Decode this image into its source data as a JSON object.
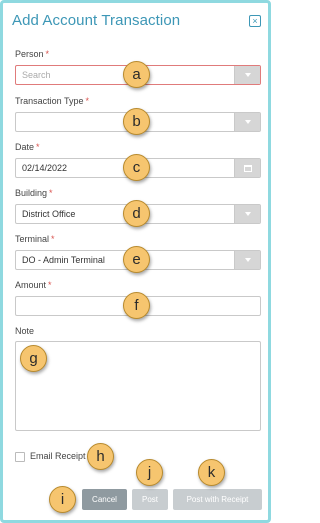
{
  "modal": {
    "title": "Add Account Transaction",
    "close_icon": "close-icon"
  },
  "fields": {
    "person": {
      "label": "Person",
      "required": "*",
      "placeholder": "Search"
    },
    "transaction_type": {
      "label": "Transaction Type",
      "required": "*",
      "value": ""
    },
    "date": {
      "label": "Date",
      "required": "*",
      "value": "02/14/2022"
    },
    "building": {
      "label": "Building",
      "required": "*",
      "value": "District Office"
    },
    "terminal": {
      "label": "Terminal",
      "required": "*",
      "value": "DO - Admin Terminal"
    },
    "amount": {
      "label": "Amount",
      "required": "*",
      "value": ""
    },
    "note": {
      "label": "Note",
      "value": ""
    }
  },
  "email_receipt": {
    "label": "Email Receipt",
    "checked": false
  },
  "buttons": {
    "cancel": "Cancel",
    "post": "Post",
    "post_with_receipt": "Post with Receipt"
  },
  "markers": [
    "a",
    "b",
    "c",
    "d",
    "e",
    "f",
    "g",
    "h",
    "i",
    "j",
    "k"
  ],
  "colors": {
    "accent": "#3d97b6",
    "modal_border": "#8fd9e0",
    "required": "#d9534f",
    "invalid_border": "#e07b7b",
    "marker_fill": "#f6c56f"
  }
}
